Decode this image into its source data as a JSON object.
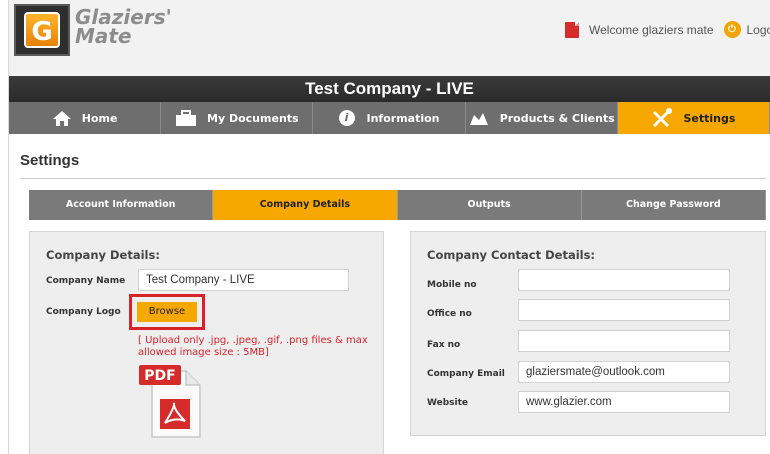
{
  "header": {
    "logo_line1": "Glaziers'",
    "logo_line2": "Mate",
    "logo_letter": "G",
    "welcome_text": "Welcome glaziers mate",
    "logout_label": "Logou"
  },
  "company_title": "Test Company - LIVE",
  "main_nav": [
    {
      "label": "Home",
      "icon": "home-icon"
    },
    {
      "label": "My Documents",
      "icon": "briefcase-icon"
    },
    {
      "label": "Information",
      "icon": "info-icon"
    },
    {
      "label": "Products & Clients",
      "icon": "products-icon"
    },
    {
      "label": "Settings",
      "icon": "wrench-screwdriver-icon",
      "active": true
    }
  ],
  "page_title": "Settings",
  "sub_nav": [
    {
      "label": "Account Information"
    },
    {
      "label": "Company Details",
      "active": true
    },
    {
      "label": "Outputs"
    },
    {
      "label": "Change Password"
    }
  ],
  "company_details": {
    "heading": "Company Details:",
    "name_label": "Company Name",
    "name_value": "Test Company - LIVE",
    "logo_label": "Company Logo",
    "browse_label": "Browse",
    "upload_note": "[ Upload only .jpg, .jpeg, .gif, .png files & max allowed image size : 5MB]",
    "pdf_badge": "PDF"
  },
  "contact_details": {
    "heading": "Company Contact Details:",
    "mobile_label": "Mobile no",
    "mobile_value": "",
    "office_label": "Office no",
    "office_value": "",
    "fax_label": "Fax no",
    "fax_value": "",
    "email_label": "Company Email",
    "email_value": "glaziersmate@outlook.com",
    "website_label": "Website",
    "website_value": "www.glazier.com"
  },
  "colors": {
    "accent": "#f7a800",
    "nav_gray": "#6e6e6e",
    "highlight_red": "#d8222a"
  }
}
